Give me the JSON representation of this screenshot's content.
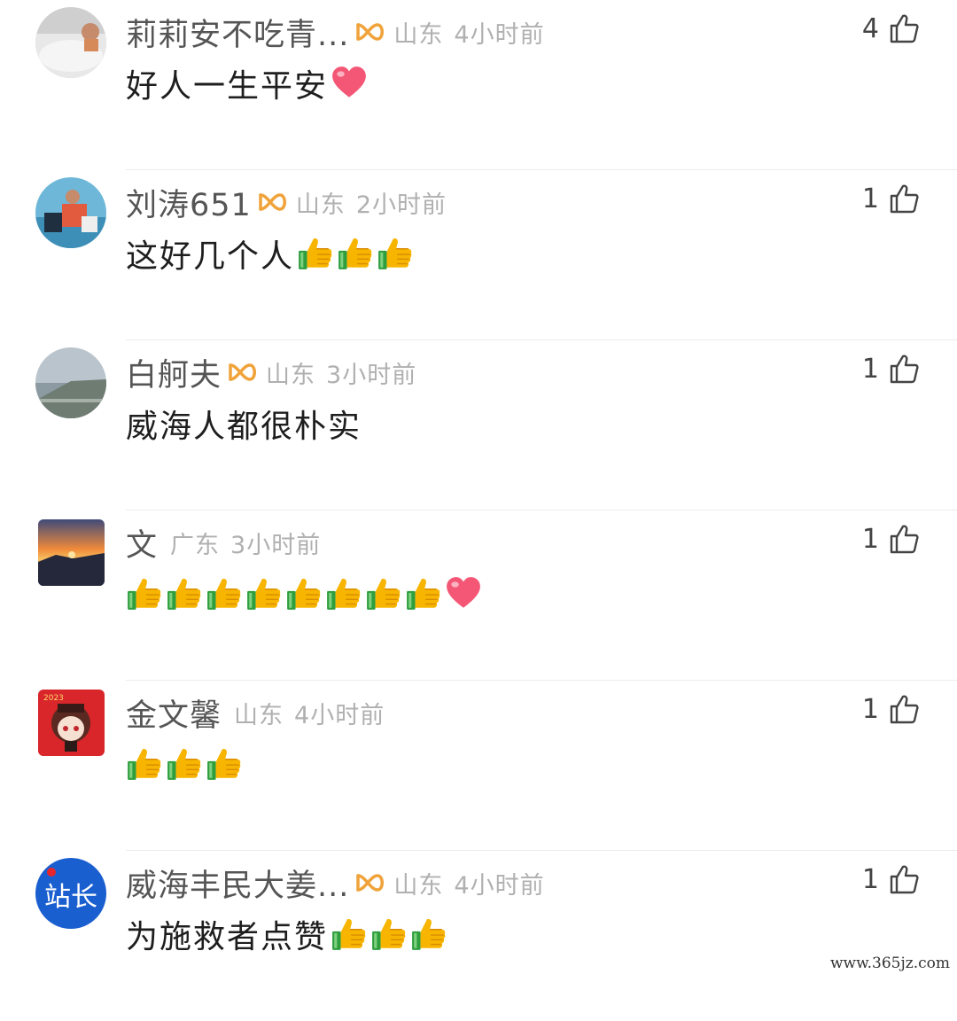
{
  "comments": [
    {
      "user": "莉莉安不吃青...",
      "badge": "gold-ribbon-badge-icon",
      "location": "山东",
      "time": "4小时前",
      "likes": "4",
      "text": "好人一生平安",
      "emojis": [
        "heart"
      ],
      "avatar": "bathtub-photo"
    },
    {
      "user": "刘涛651",
      "badge": "gold-ribbon-badge-icon",
      "location": "山东",
      "time": "2小时前",
      "likes": "1",
      "text": "这好几个人",
      "emojis": [
        "thumbsup",
        "thumbsup",
        "thumbsup"
      ],
      "avatar": "group-photo"
    },
    {
      "user": "白舸夫",
      "badge": "gold-ribbon-badge-icon",
      "location": "山东",
      "time": "3小时前",
      "likes": "1",
      "text": "威海人都很朴实",
      "emojis": [],
      "avatar": "coast-photo"
    },
    {
      "user": "文",
      "badge": null,
      "location": "广东",
      "time": "3小时前",
      "likes": "1",
      "text": "",
      "emojis": [
        "thumbsup",
        "thumbsup",
        "thumbsup",
        "thumbsup",
        "thumbsup",
        "thumbsup",
        "thumbsup",
        "thumbsup",
        "heart"
      ],
      "avatar": "sunset-photo"
    },
    {
      "user": "金文馨",
      "badge": null,
      "location": "山东",
      "time": "4小时前",
      "likes": "1",
      "text": "",
      "emojis": [
        "thumbsup",
        "thumbsup",
        "thumbsup"
      ],
      "avatar": "anime-girl-drawing"
    },
    {
      "user": "威海丰民大姜...",
      "badge": "gold-ribbon-badge-icon",
      "location": "山东",
      "time": "4小时前",
      "likes": "1",
      "text": "为施救者点赞",
      "emojis": [
        "thumbsup",
        "thumbsup",
        "thumbsup"
      ],
      "avatar": "站长-logo"
    }
  ],
  "watermark": "www.365jz.com",
  "colors": {
    "username": "#555555",
    "meta": "#b0b0b0",
    "divider": "#ececec",
    "badge": "#f0a33a"
  }
}
